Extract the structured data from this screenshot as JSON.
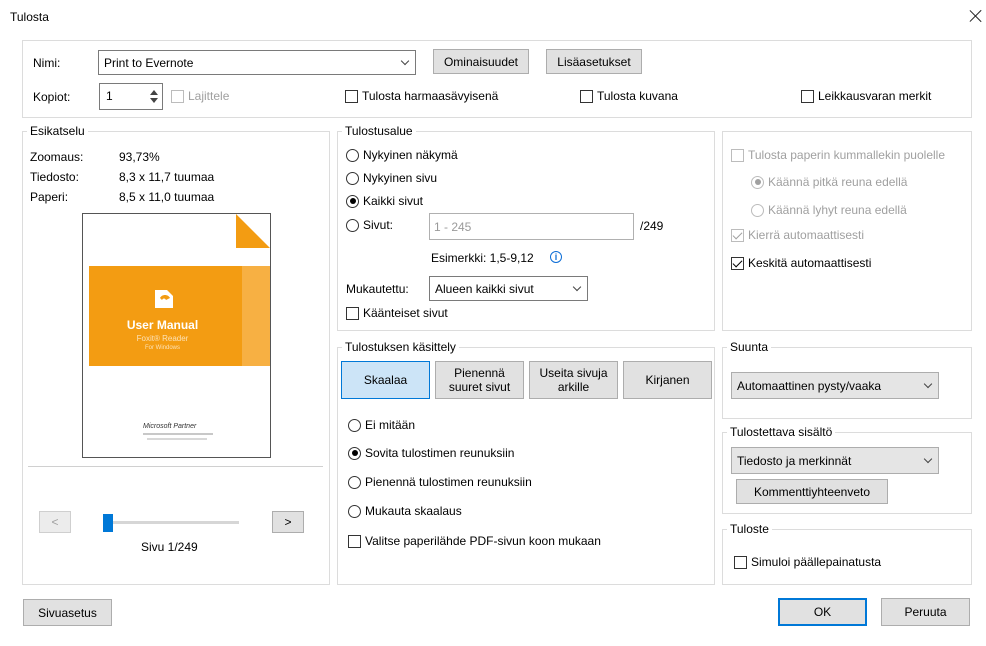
{
  "dialog": {
    "title": "Tulosta"
  },
  "printer": {
    "name_label": "Nimi:",
    "name_value": "Print to Evernote",
    "properties_button": "Ominaisuudet",
    "advanced_button": "Lisäasetukset",
    "copies_label": "Kopiot:",
    "copies_value": "1",
    "collate_label": "Lajittele",
    "grayscale_label": "Tulosta harmaasävyisenä",
    "as_image_label": "Tulosta kuvana",
    "crop_marks_label": "Leikkausvaran merkit"
  },
  "preview": {
    "legend": "Esikatselu",
    "zoom_label": "Zoomaus:",
    "zoom_value": "93,73%",
    "document_label": "Tiedosto:",
    "document_value": "8,3 x 11,7 tuumaa",
    "paper_label": "Paperi:",
    "paper_value": "8,5 x 11,0 tuumaa",
    "thumb": {
      "title": "User Manual",
      "product": "Foxit® Reader",
      "platform": "For Windows",
      "partner": "Microsoft Partner"
    },
    "prev_button": "<",
    "next_button": ">",
    "page_indicator": "Sivu 1/249"
  },
  "print_range": {
    "legend": "Tulostusalue",
    "current_view": "Nykyinen näkymä",
    "current_page": "Nykyinen sivu",
    "all_pages": "Kaikki sivut",
    "pages_label": "Sivut:",
    "pages_placeholder": "1 - 245",
    "pages_total": "/249",
    "example": "Esimerkki: 1,5-9,12",
    "custom_label": "Mukautettu:",
    "custom_value": "Alueen kaikki sivut",
    "reverse_label": "Käänteiset sivut"
  },
  "duplex": {
    "both_sides": "Tulosta paperin kummallekin puolelle",
    "long_edge": "Käännä pitkä reuna edellä",
    "short_edge": "Käännä lyhyt reuna edellä",
    "auto_rotate": "Kierrä automaattisesti",
    "auto_center": "Keskitä automaattisesti"
  },
  "handling": {
    "legend": "Tulostuksen käsittely",
    "tabs": [
      "Skaalaa",
      "Pienennä suuret sivut",
      "Useita sivuja arkille",
      "Kirjanen"
    ],
    "none": "Ei mitään",
    "fit": "Sovita tulostimen reunuksiin",
    "shrink": "Pienennä tulostimen reunuksiin",
    "custom": "Mukauta skaalaus",
    "paper_source": "Valitse paperilähde PDF-sivun koon mukaan"
  },
  "orientation": {
    "legend": "Suunta",
    "value": "Automaattinen pysty/vaaka"
  },
  "content": {
    "legend": "Tulostettava sisältö",
    "value": "Tiedosto ja merkinnät",
    "summary_button": "Kommenttiyhteenveto"
  },
  "output": {
    "legend": "Tuloste",
    "simulate_label": "Simuloi päällepainatusta"
  },
  "footer": {
    "page_setup": "Sivuasetus",
    "ok": "OK",
    "cancel": "Peruuta"
  },
  "colors": {
    "accent": "#0078d7",
    "orange": "#f39c12"
  }
}
